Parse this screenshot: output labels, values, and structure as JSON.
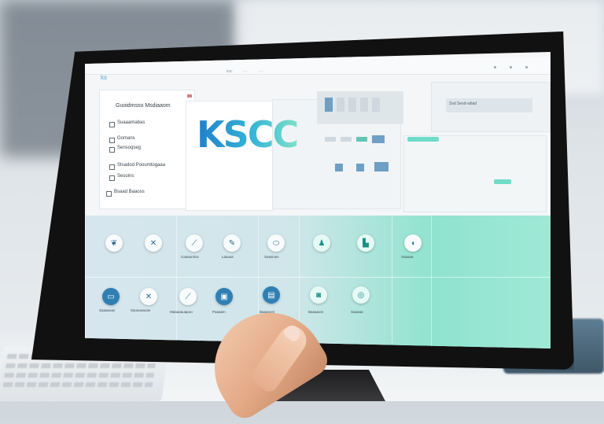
{
  "screen": {
    "hero_text": "KSCC",
    "topbar": {
      "logo": "ks",
      "mid_labels": [
        "ksc",
        "····",
        "····"
      ]
    },
    "left_panel": {
      "title": "Guoidmsso Msdiaaom",
      "items": [
        "Suaaamabas",
        "Gomans",
        "Sensoqseg",
        "Stsadod Pooumtogaaa",
        "Sesoins",
        "Bsaad Baaoss"
      ]
    },
    "card_right": {
      "label": "Ssd Sesd-sdiad"
    },
    "grid_icons_row1": [
      {
        "caption": ""
      },
      {
        "caption": ""
      },
      {
        "caption": "Caaaomlos"
      },
      {
        "caption": "Laauas"
      },
      {
        "caption": "Saasioes"
      },
      {
        "caption": ""
      },
      {
        "caption": ""
      },
      {
        "caption": "Saaaaa"
      }
    ],
    "grid_icons_row2": [
      {
        "caption": "Saaaaoas"
      },
      {
        "caption": "Saoaoaaoas"
      },
      {
        "caption": "Maaaaauapoo"
      },
      {
        "caption": "Paaaam"
      },
      {
        "caption": "Baaaaom"
      },
      {
        "caption": "Baaaaom"
      },
      {
        "caption": "Saaaaa"
      }
    ],
    "colors": {
      "brand_blue": "#2a9bd1",
      "teal": "#6fdcc9",
      "dark_icon": "#2f7fb3"
    }
  }
}
